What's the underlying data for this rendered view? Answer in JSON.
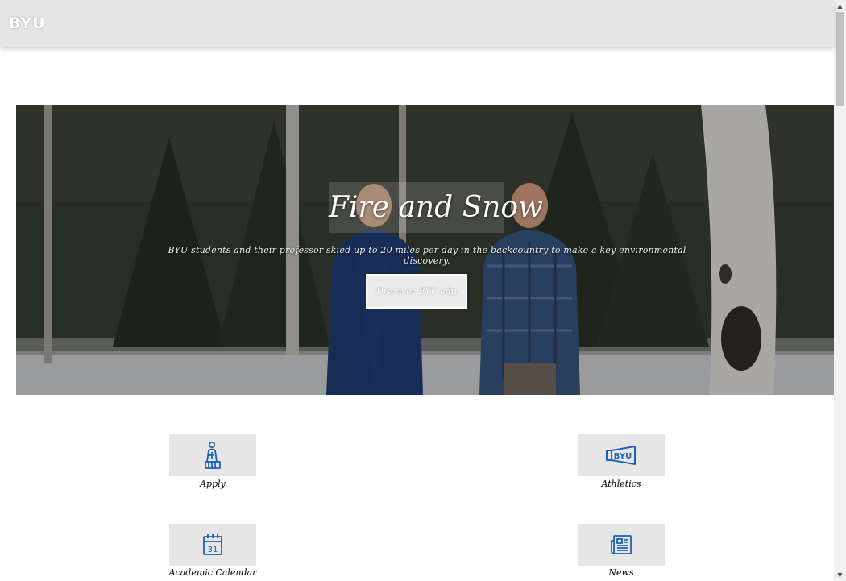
{
  "header": {
    "logo": "BYU"
  },
  "hero": {
    "title": "Fire and Snow",
    "subtitle": "BYU students and their professor skied up to 20 miles per day in the backcountry to make a key environmental discovery.",
    "button_label": "Discover BYU.edu"
  },
  "quick_links": [
    {
      "label": "Apply",
      "icon": "student-statue-icon"
    },
    {
      "label": "Athletics",
      "icon": "byu-megaphone-icon"
    },
    {
      "label": "Academic Calendar",
      "icon": "calendar-icon"
    },
    {
      "label": "News",
      "icon": "newspaper-icon"
    }
  ],
  "calendar_day": "31",
  "megaphone_text": "BYU",
  "colors": {
    "icon_blue": "#1b62b8",
    "header_bg": "#e6e6e6",
    "tile_bg": "#e6e6e6"
  }
}
